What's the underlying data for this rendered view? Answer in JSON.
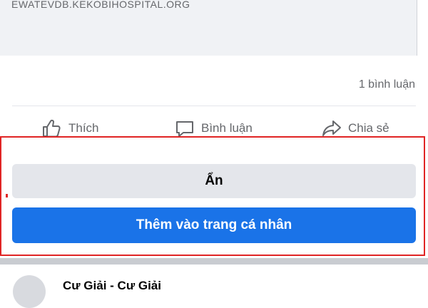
{
  "link_preview": {
    "domain": "EWATEVDB.KEKOBIHOSPITAL.ORG"
  },
  "post_stats": {
    "comment_count": "1 bình luận"
  },
  "actions": {
    "like_label": "Thích",
    "comment_label": "Bình luận",
    "share_label": "Chia sẻ"
  },
  "menu": {
    "hide_label": "Ẩn",
    "add_to_profile_label": "Thêm vào trang cá nhân"
  },
  "next_post": {
    "author_name": "Cư Giải - Cư Giải"
  },
  "colors": {
    "primary_button": "#1a73e8",
    "secondary_button": "#e4e6eb",
    "highlight_border": "#e02424"
  }
}
